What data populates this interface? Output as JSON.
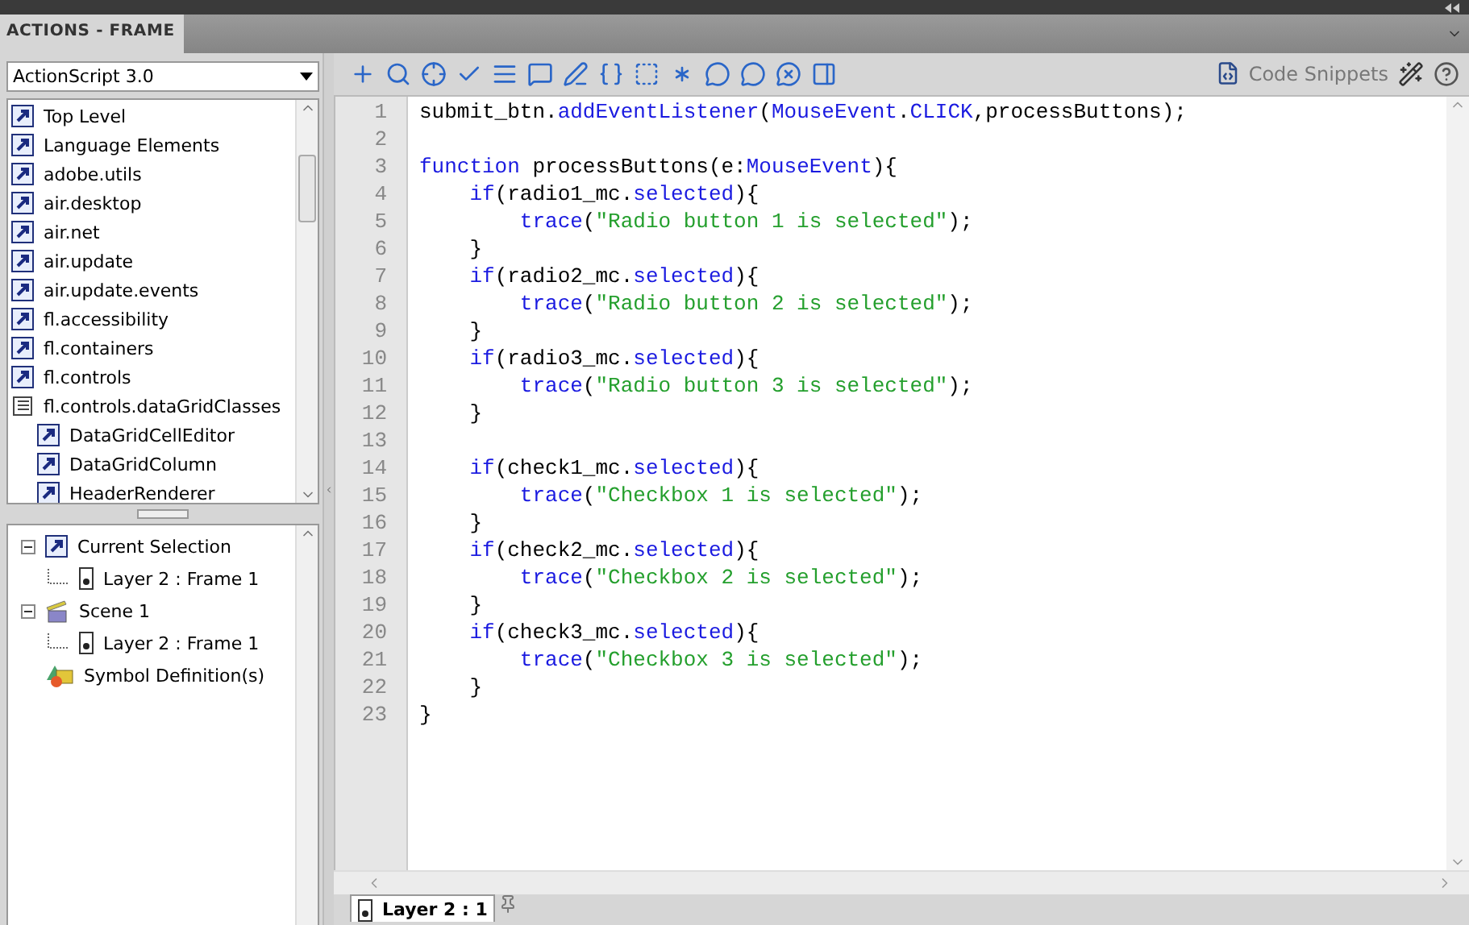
{
  "panel": {
    "title": "ACTIONS - FRAME"
  },
  "language_select": {
    "value": "ActionScript 3.0"
  },
  "toolbox": [
    {
      "label": "Top Level",
      "kind": "class"
    },
    {
      "label": "Language Elements",
      "kind": "class"
    },
    {
      "label": "adobe.utils",
      "kind": "class"
    },
    {
      "label": "air.desktop",
      "kind": "class"
    },
    {
      "label": "air.net",
      "kind": "class"
    },
    {
      "label": "air.update",
      "kind": "class"
    },
    {
      "label": "air.update.events",
      "kind": "class"
    },
    {
      "label": "fl.accessibility",
      "kind": "class"
    },
    {
      "label": "fl.containers",
      "kind": "class"
    },
    {
      "label": "fl.controls",
      "kind": "class"
    },
    {
      "label": "fl.controls.dataGridClasses",
      "kind": "book",
      "children": [
        {
          "label": "DataGridCellEditor",
          "kind": "class"
        },
        {
          "label": "DataGridColumn",
          "kind": "class"
        },
        {
          "label": "HeaderRenderer",
          "kind": "class"
        }
      ]
    }
  ],
  "script_navigator": [
    {
      "label": "Current Selection",
      "kind": "selection",
      "expanded": true,
      "children": [
        {
          "label": "Layer 2 : Frame 1",
          "kind": "frame"
        }
      ]
    },
    {
      "label": "Scene 1",
      "kind": "scene",
      "expanded": true,
      "children": [
        {
          "label": "Layer 2 : Frame 1",
          "kind": "frame"
        }
      ]
    },
    {
      "label": "Symbol Definition(s)",
      "kind": "symbol"
    }
  ],
  "toolbar": {
    "code_snippets": "Code Snippets"
  },
  "code": [
    {
      "number": "1",
      "segments": [
        {
          "kind": "plain",
          "text": "submit_btn."
        },
        {
          "kind": "keyword",
          "text": "addEventListener"
        },
        {
          "kind": "plain",
          "text": "("
        },
        {
          "kind": "keyword",
          "text": "MouseEvent"
        },
        {
          "kind": "plain",
          "text": "."
        },
        {
          "kind": "keyword",
          "text": "CLICK"
        },
        {
          "kind": "plain",
          "text": ",processButtons);"
        }
      ]
    },
    {
      "number": "2"
    },
    {
      "number": "3",
      "segments": [
        {
          "kind": "keyword",
          "text": "function"
        },
        {
          "kind": "plain",
          "text": " processButtons(e:"
        },
        {
          "kind": "keyword",
          "text": "MouseEvent"
        },
        {
          "kind": "plain",
          "text": "){"
        }
      ]
    },
    {
      "number": "4",
      "segments": [
        {
          "kind": "keyword",
          "text": "    if"
        },
        {
          "kind": "plain",
          "text": "(radio1_mc."
        },
        {
          "kind": "keyword",
          "text": "selected"
        },
        {
          "kind": "plain",
          "text": "){"
        }
      ]
    },
    {
      "number": "5",
      "segments": [
        {
          "kind": "keyword",
          "text": "        trace"
        },
        {
          "kind": "plain",
          "text": "("
        },
        {
          "kind": "string",
          "text": "\"Radio button 1 is selected\""
        },
        {
          "kind": "plain",
          "text": ");"
        }
      ]
    },
    {
      "number": "6",
      "segments": [
        {
          "kind": "plain",
          "text": "    }"
        }
      ]
    },
    {
      "number": "7",
      "segments": [
        {
          "kind": "keyword",
          "text": "    if"
        },
        {
          "kind": "plain",
          "text": "(radio2_mc."
        },
        {
          "kind": "keyword",
          "text": "selected"
        },
        {
          "kind": "plain",
          "text": "){"
        }
      ]
    },
    {
      "number": "8",
      "segments": [
        {
          "kind": "keyword",
          "text": "        trace"
        },
        {
          "kind": "plain",
          "text": "("
        },
        {
          "kind": "string",
          "text": "\"Radio button 2 is selected\""
        },
        {
          "kind": "plain",
          "text": ");"
        }
      ]
    },
    {
      "number": "9",
      "segments": [
        {
          "kind": "plain",
          "text": "    }"
        }
      ]
    },
    {
      "number": "10",
      "segments": [
        {
          "kind": "keyword",
          "text": "    if"
        },
        {
          "kind": "plain",
          "text": "(radio3_mc."
        },
        {
          "kind": "keyword",
          "text": "selected"
        },
        {
          "kind": "plain",
          "text": "){"
        }
      ]
    },
    {
      "number": "11",
      "segments": [
        {
          "kind": "keyword",
          "text": "        trace"
        },
        {
          "kind": "plain",
          "text": "("
        },
        {
          "kind": "string",
          "text": "\"Radio button 3 is selected\""
        },
        {
          "kind": "plain",
          "text": ");"
        }
      ]
    },
    {
      "number": "12",
      "segments": [
        {
          "kind": "plain",
          "text": "    }"
        }
      ]
    },
    {
      "number": "13"
    },
    {
      "number": "14",
      "segments": [
        {
          "kind": "keyword",
          "text": "    if"
        },
        {
          "kind": "plain",
          "text": "(check1_mc."
        },
        {
          "kind": "keyword",
          "text": "selected"
        },
        {
          "kind": "plain",
          "text": "){"
        }
      ]
    },
    {
      "number": "15",
      "segments": [
        {
          "kind": "keyword",
          "text": "        trace"
        },
        {
          "kind": "plain",
          "text": "("
        },
        {
          "kind": "string",
          "text": "\"Checkbox 1 is selected\""
        },
        {
          "kind": "plain",
          "text": ");"
        }
      ]
    },
    {
      "number": "16",
      "segments": [
        {
          "kind": "plain",
          "text": "    }"
        }
      ]
    },
    {
      "number": "17",
      "segments": [
        {
          "kind": "keyword",
          "text": "    if"
        },
        {
          "kind": "plain",
          "text": "(check2_mc."
        },
        {
          "kind": "keyword",
          "text": "selected"
        },
        {
          "kind": "plain",
          "text": "){"
        }
      ]
    },
    {
      "number": "18",
      "segments": [
        {
          "kind": "keyword",
          "text": "        trace"
        },
        {
          "kind": "plain",
          "text": "("
        },
        {
          "kind": "string",
          "text": "\"Checkbox 2 is selected\""
        },
        {
          "kind": "plain",
          "text": ");"
        }
      ]
    },
    {
      "number": "19",
      "segments": [
        {
          "kind": "plain",
          "text": "    }"
        }
      ]
    },
    {
      "number": "20",
      "segments": [
        {
          "kind": "keyword",
          "text": "    if"
        },
        {
          "kind": "plain",
          "text": "(check3_mc."
        },
        {
          "kind": "keyword",
          "text": "selected"
        },
        {
          "kind": "plain",
          "text": "){"
        }
      ]
    },
    {
      "number": "21",
      "segments": [
        {
          "kind": "keyword",
          "text": "        trace"
        },
        {
          "kind": "plain",
          "text": "("
        },
        {
          "kind": "string",
          "text": "\"Checkbox 3 is selected\""
        },
        {
          "kind": "plain",
          "text": ");"
        }
      ]
    },
    {
      "number": "22",
      "segments": [
        {
          "kind": "plain",
          "text": "    }"
        }
      ]
    },
    {
      "number": "23",
      "segments": [
        {
          "kind": "plain",
          "text": "}"
        }
      ]
    }
  ],
  "bottom_tabs": [
    {
      "label": "Layer 2 : 1",
      "selected": true
    }
  ]
}
